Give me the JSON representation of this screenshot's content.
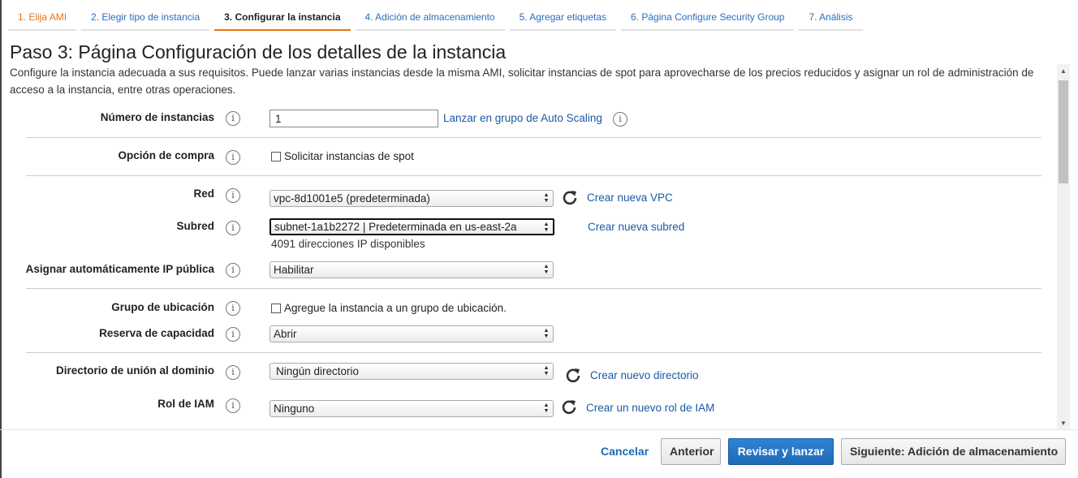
{
  "steps": [
    {
      "label": "1. Elija AMI",
      "state": "done"
    },
    {
      "label": "2. Elegir tipo de instancia",
      "state": "link"
    },
    {
      "label": "3. Configurar la instancia",
      "state": "active"
    },
    {
      "label": "4. Adición de almacenamiento",
      "state": "link"
    },
    {
      "label": "5. Agregar etiquetas",
      "state": "link"
    },
    {
      "label": "6. Página Configure Security Group",
      "state": "link"
    },
    {
      "label": "7. Análisis",
      "state": "link"
    }
  ],
  "page": {
    "title": "Paso 3: Página Configuración de los detalles de la instancia",
    "description": "Configure la instancia adecuada a sus requisitos. Puede lanzar varias instancias desde la misma AMI, solicitar instancias de spot para aprovecharse de los precios reducidos y asignar un rol de administración de acceso a la instancia, entre otras operaciones."
  },
  "form": {
    "instances": {
      "label": "Número de instancias",
      "value": "1",
      "link": "Lanzar en grupo de Auto Scaling"
    },
    "purchase": {
      "label": "Opción de compra",
      "checkbox": "Solicitar instancias de spot"
    },
    "network": {
      "label": "Red",
      "value": "vpc-8d1001e5 (predeterminada)",
      "link": "Crear nueva VPC"
    },
    "subnet": {
      "label": "Subred",
      "value": "subnet-1a1b2272 | Predeterminada en us-east-2a",
      "hint": "4091 direcciones IP disponibles",
      "link": "Crear nueva subred"
    },
    "public_ip": {
      "label": "Asignar automáticamente IP pública",
      "value": "Habilitar"
    },
    "placement": {
      "label": "Grupo de ubicación",
      "checkbox": "Agregue la instancia a un grupo de ubicación."
    },
    "capacity": {
      "label": "Reserva de capacidad",
      "value": "Abrir"
    },
    "domain": {
      "label": "Directorio de unión al dominio",
      "value": "Ningún directorio",
      "link": "Crear nuevo directorio"
    },
    "iam": {
      "label": "Rol de IAM",
      "value": "Ninguno",
      "link": "Crear un nuevo rol de IAM"
    }
  },
  "info_glyph": "i",
  "footer": {
    "cancel": "Cancelar",
    "previous": "Anterior",
    "review": "Revisar y lanzar",
    "next": "Siguiente: Adición de almacenamiento"
  },
  "colors": {
    "accent": "#ec7211",
    "link": "#1a5aa3",
    "primary": "#1e6bb8"
  }
}
